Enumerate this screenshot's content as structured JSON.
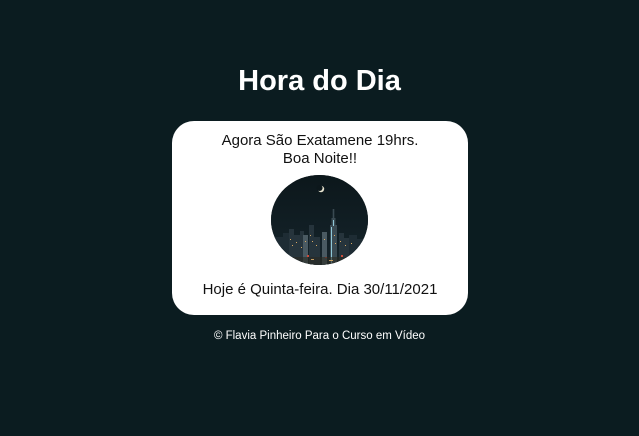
{
  "header": {
    "title": "Hora do Dia"
  },
  "card": {
    "time_message": "Agora São Exatamene 19hrs.",
    "greeting": "Boa Noite!!",
    "date_message": "Hoje é Quinta-feira. Dia 30/11/2021",
    "image": {
      "icon": "night-city-skyline-image"
    }
  },
  "footer": {
    "credit": "© Flavia Pinheiro Para o Curso em Vídeo"
  },
  "colors": {
    "background": "#0b1c20",
    "card": "#ffffff",
    "text": "#111111"
  }
}
